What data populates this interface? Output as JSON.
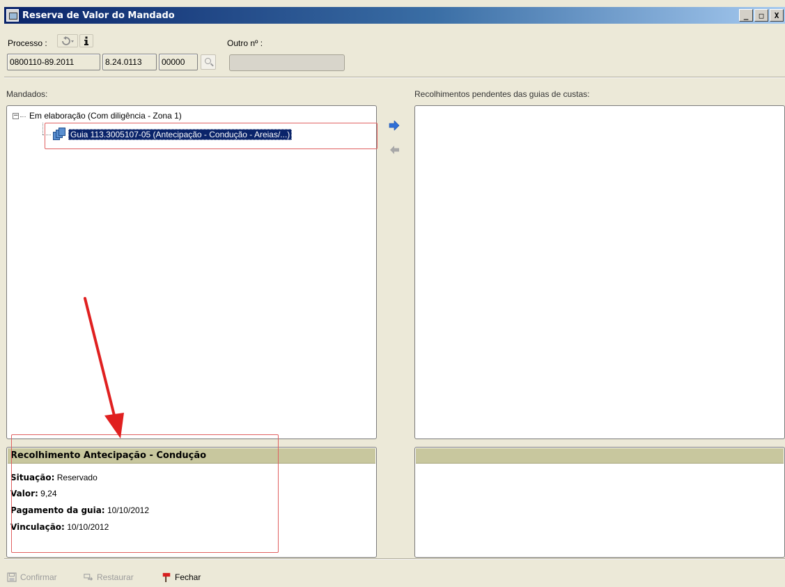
{
  "window": {
    "title": "Reserva de Valor do Mandado",
    "controls": [
      "_",
      "□",
      "X"
    ]
  },
  "processo": {
    "label": "Processo :",
    "numero": "0800110-89.2011",
    "orgao": "8.24.0113",
    "sufixo": "00000",
    "outro_label": "Outro nº :",
    "outro_value": ""
  },
  "mandados": {
    "label": "Mandados:",
    "expander": "−",
    "group_label": "Em elaboração (Com diligência - Zona 1)",
    "item_label": "Guia 113.3005107-05 (Antecipação - Condução - Areias/...)"
  },
  "recolhimentos": {
    "label": "Recolhimentos pendentes das guias de custas:"
  },
  "detail": {
    "header": "Recolhimento Antecipação - Condução",
    "situacao_label": "Situação:",
    "situacao_value": "Reservado",
    "valor_label": "Valor:",
    "valor_value": "9,24",
    "pagamento_label": "Pagamento da guia:",
    "pagamento_value": "10/10/2012",
    "vinculacao_label": "Vinculação:",
    "vinculacao_value": "10/10/2012"
  },
  "toolbar": {
    "confirmar": "Confirmar",
    "restaurar": "Restaurar",
    "fechar": "Fechar"
  },
  "colors": {
    "titlebar": "#0a246a",
    "selection": "#0a246a",
    "detail_header": "#c8c79e",
    "highlight": "#e06060",
    "annotation_arrow": "#e02020",
    "arrow_active": "#2f6fd6"
  },
  "icons": {
    "app": "window-app-icon",
    "undo": "undo-icon",
    "info": "info-icon",
    "search": "search-icon",
    "guia": "document-stack-icon",
    "move_right": "arrow-right-icon",
    "move_left": "arrow-left-icon",
    "confirmar": "save-icon",
    "restaurar": "restore-icon",
    "fechar": "flag-icon"
  }
}
